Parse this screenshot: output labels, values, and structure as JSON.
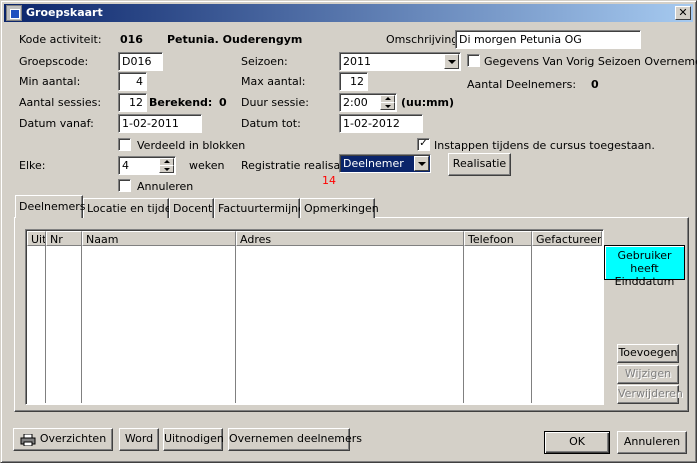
{
  "window": {
    "title": "Groepskaart",
    "close_label": "✕"
  },
  "form": {
    "kode_label": "Kode activiteit:",
    "kode_value": "016",
    "kode_name": "Petunia. Ouderengym",
    "omschrijving_label": "Omschrijving:",
    "omschrijving_value": "Di morgen Petunia OG",
    "groepscode_label": "Groepscode:",
    "groepscode_value": "D016",
    "seizoen_label": "Seizoen:",
    "seizoen_value": "2011",
    "gegevens_label": "Gegevens Van Vorig Seizoen Overnemen",
    "min_label": "Min aantal:",
    "min_value": "4",
    "max_label": "Max aantal:",
    "max_value": "12",
    "aantal_deelnemers_label": "Aantal Deelnemers:",
    "aantal_deelnemers_value": "0",
    "sessies_label": "Aantal sessies:",
    "sessies_value": "12",
    "berekend_label": "Berekend:",
    "berekend_value": "0",
    "duur_label": "Duur sessie:",
    "duur_value": "2:00",
    "duur_unit": "(uu:mm)",
    "vanaf_label": "Datum vanaf:",
    "vanaf_value": "1-02-2011",
    "tot_label": "Datum tot:",
    "tot_value": "1-02-2012",
    "verdeeld_label": "Verdeeld in blokken",
    "instappen_label": "Instappen tijdens de cursus toegestaan.",
    "instappen_check": "✓",
    "elke_label": "Elke:",
    "elke_value": "4",
    "weken_label": "weken",
    "registratie_label": "Registratie realisatie:",
    "registratie_value": "Deelnemer",
    "realisatie_button": "Realisatie",
    "count_value": "14",
    "annuleren_label": "Annuleren"
  },
  "tabs": [
    {
      "label": "Deelnemers",
      "active": true
    },
    {
      "label": "Locatie en tijden",
      "active": false
    },
    {
      "label": "Docent",
      "active": false
    },
    {
      "label": "Factuurtermijnen",
      "active": false
    },
    {
      "label": "Opmerkingen",
      "active": false
    }
  ],
  "grid": {
    "columns": [
      "Uit",
      "Nr",
      "Naam",
      "Adres",
      "Telefoon",
      "Gefactureerd"
    ]
  },
  "side_buttons": {
    "gebruiker_line1": "Gebruiker heeft",
    "gebruiker_line2": "Einddatum",
    "toevoegen": "Toevoegen",
    "wijzigen": "Wijzigen",
    "verwijderen": "Verwijderen"
  },
  "bottom": {
    "overzichten": "Overzichten",
    "word": "Word",
    "uitnodigen": "Uitnodigen",
    "overnemen": "Overnemen deelnemers",
    "ok": "OK",
    "annuleren": "Annuleren"
  },
  "colors": {
    "accent_cyan": "#00ffff",
    "count_red": "#ff0000",
    "selection": "#0a246a"
  }
}
